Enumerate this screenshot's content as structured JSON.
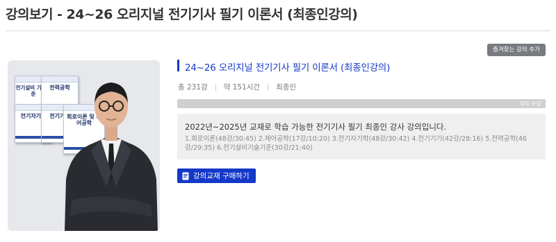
{
  "page": {
    "heading": "강의보기 - 24~26 오리지널 전기기사 필기 이론서 (최종인강의)"
  },
  "actions": {
    "favorite_label": "즐겨찾는 강의 추가",
    "buy_label": "강의교재 구매하기"
  },
  "thumbnail": {
    "books": [
      "전기설비 기술기준",
      "전력공학",
      "전기자기학",
      "전기기기",
      "회로이론 및 제어공학"
    ]
  },
  "course": {
    "title": "24~26 오리지널 전기기사 필기 이론서 (최종인강의)",
    "lecture_count": "총 231강",
    "duration": "약 151시간",
    "instructor": "최종인",
    "progress_percent": 0,
    "progress_label": "0% 수강",
    "description": "2022년~2025년 교재로 학습 가능한 전기기사 필기 최종인 강사 강의입니다.",
    "curriculum": "1.회로이론(48강/30:45) 2.제어공학(17강/10:20) 3.전기자기학(48강/30:42) 4.전기기기(42강/28:16) 5.전력공학(46강/29:35) 6.전기설비기술기준(30강/21:40)"
  },
  "colors": {
    "accent": "#1438c8",
    "progress_track": "#cfcfcf",
    "favorite_button": "#777a7e",
    "description_bg": "#efefef"
  },
  "icons": {
    "buy": "book-icon"
  }
}
